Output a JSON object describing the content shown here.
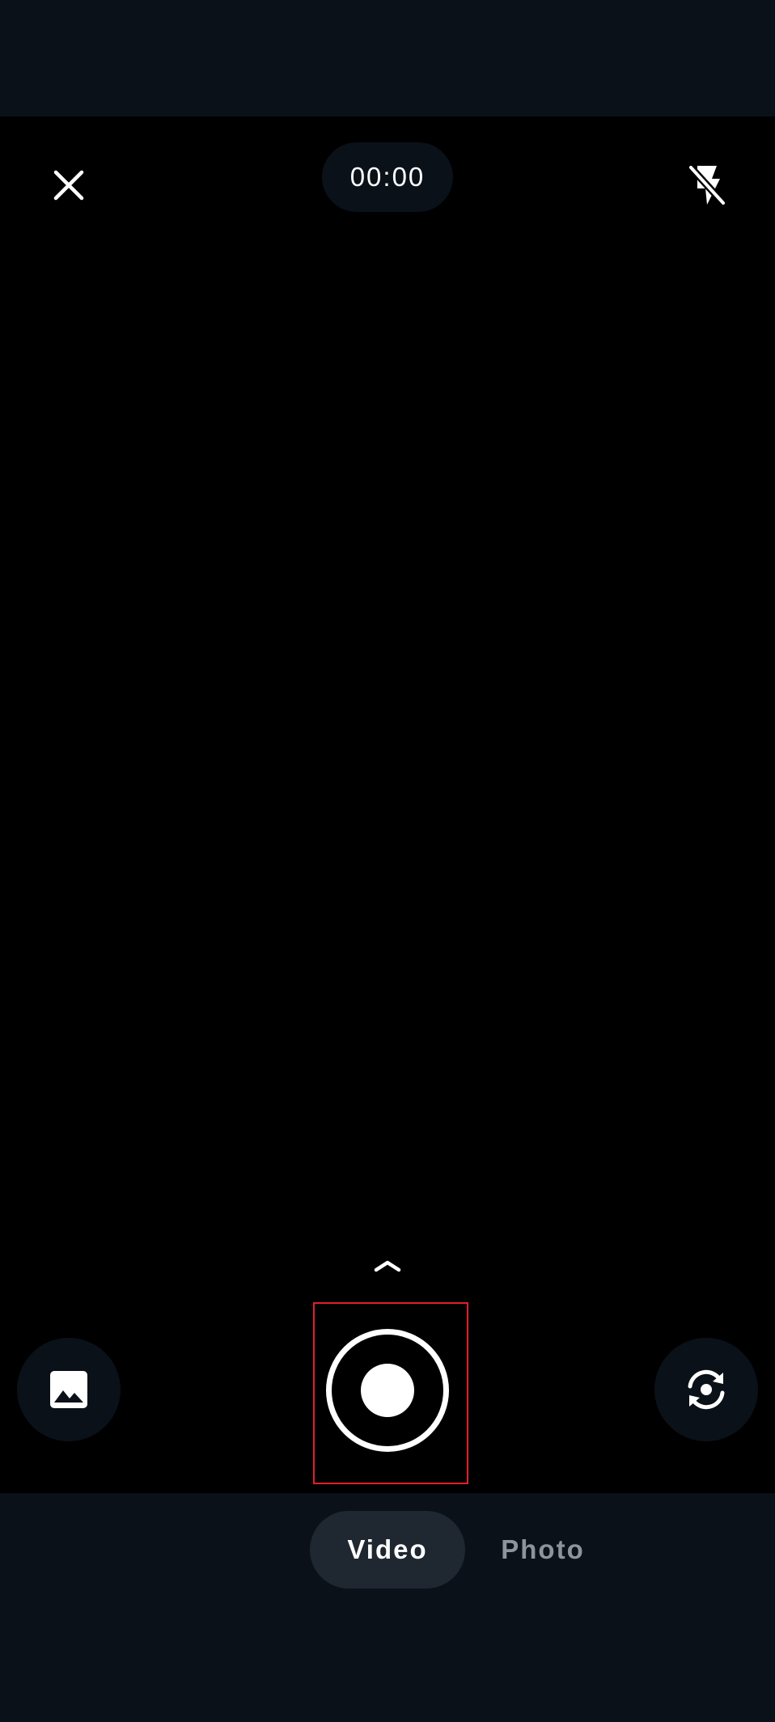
{
  "camera": {
    "timer": "00:00",
    "icons": {
      "close": "close-icon",
      "flash": "flash-off-icon",
      "expand": "chevron-up-icon",
      "gallery": "image-icon",
      "record": "record-icon",
      "switch_camera": "switch-camera-icon"
    },
    "modes": [
      {
        "label": "Video",
        "selected": true
      },
      {
        "label": "Photo",
        "selected": false
      }
    ]
  },
  "colors": {
    "background": "#0b1119",
    "viewfinder": "#000000",
    "selected_tab": "#1f2731",
    "inactive_text": "#8e949b",
    "highlight": "#e0202c"
  }
}
